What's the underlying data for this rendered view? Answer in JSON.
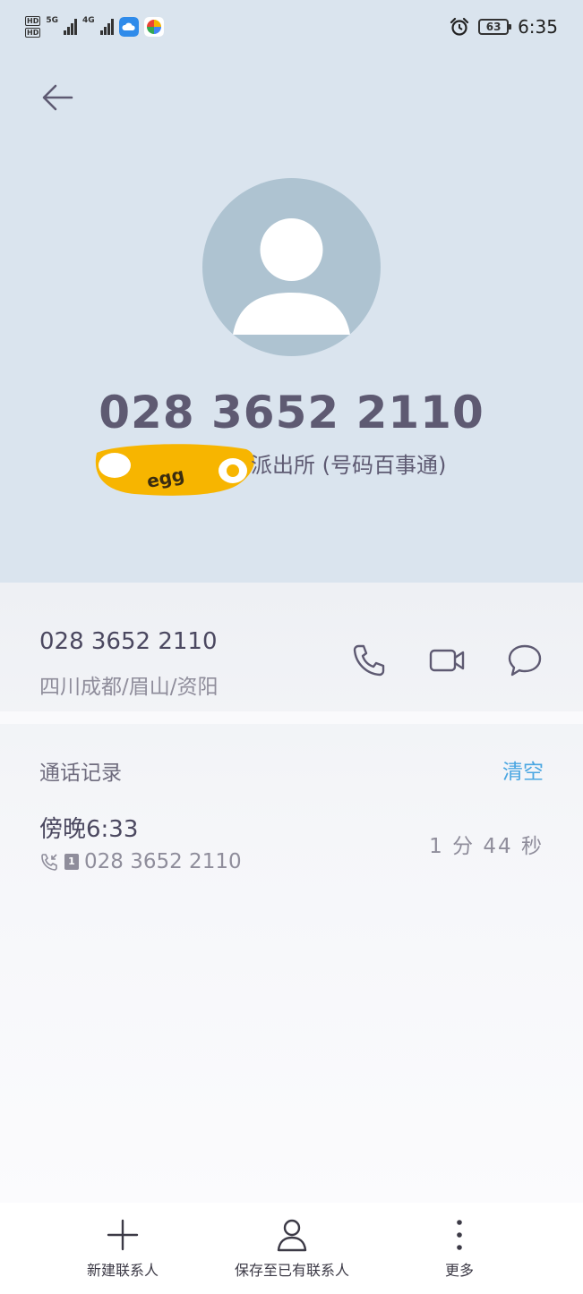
{
  "status_bar": {
    "hd_labels": [
      "HD",
      "HD"
    ],
    "network_5g": "5G",
    "network_4g": "4G",
    "battery": "63",
    "time": "6:35",
    "icons": [
      "alarm-icon",
      "cloud-app-icon",
      "pinwheel-app-icon"
    ]
  },
  "header": {
    "phone_number": "028 3652 2110",
    "tag_text": "派出所 (号码百事通)",
    "sticker_text": "egg",
    "colors": {
      "background": "#dae4ee",
      "avatar": "#aec3d1"
    }
  },
  "number_row": {
    "number": "028 3652 2110",
    "location": "四川成都/眉山/资阳"
  },
  "call_log": {
    "title": "通话记录",
    "clear_label": "清空",
    "entries": [
      {
        "time": "傍晚6:33",
        "sim": "1",
        "number": "028 3652 2110",
        "duration": "1 分 44 秒"
      }
    ]
  },
  "bottom_bar": {
    "new_contact": "新建联系人",
    "save_existing": "保存至已有联系人",
    "more": "更多"
  },
  "accent_color": "#4aa6e2"
}
